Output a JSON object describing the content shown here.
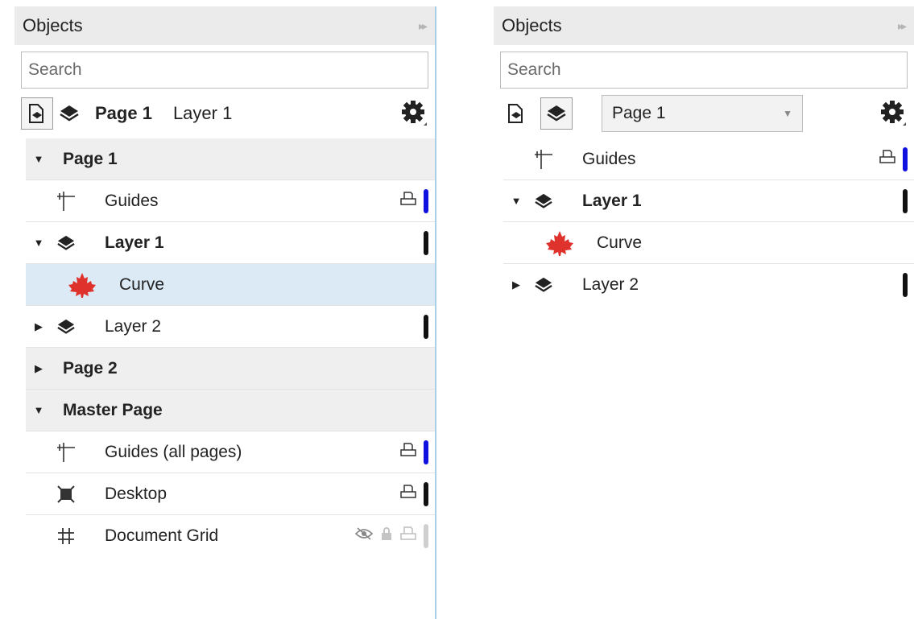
{
  "left": {
    "title": "Objects",
    "search_placeholder": "Search",
    "toolbar": {
      "page": "Page 1",
      "layer": "Layer 1"
    },
    "tree": {
      "page1": "Page 1",
      "guides": "Guides",
      "layer1": "Layer 1",
      "curve": "Curve",
      "layer2": "Layer 2",
      "page2": "Page 2",
      "master": "Master Page",
      "guides_all": "Guides (all pages)",
      "desktop": "Desktop",
      "grid": "Document Grid"
    }
  },
  "right": {
    "title": "Objects",
    "search_placeholder": "Search",
    "dropdown_value": "Page 1",
    "tree": {
      "guides": "Guides",
      "layer1": "Layer 1",
      "curve": "Curve",
      "layer2": "Layer 2"
    }
  },
  "colors": {
    "guides_bar": "#1010e0",
    "layer_bar": "#111111",
    "selection": "#dceaf6",
    "leaf": "#e0322c"
  }
}
